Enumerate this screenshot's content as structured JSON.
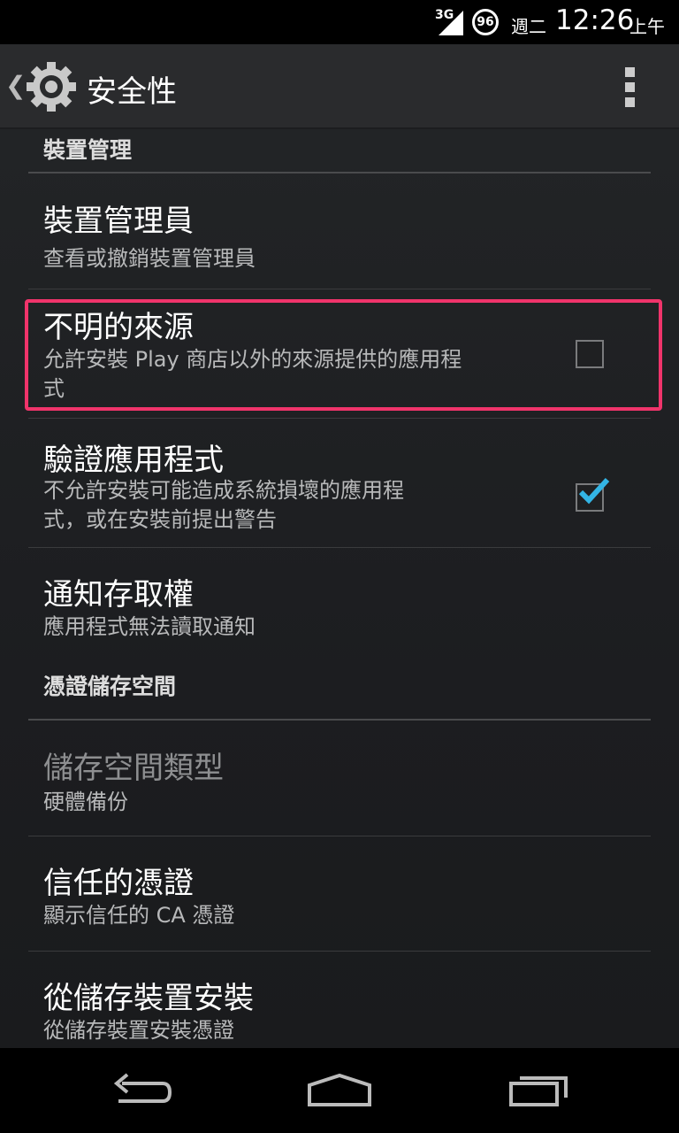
{
  "status_bar": {
    "network": "3G",
    "battery": "96",
    "day": "週二",
    "time": "12:26",
    "ampm": "上午"
  },
  "action_bar": {
    "title": "安全性",
    "icon": "gear-icon",
    "overflow_icon": "overflow-menu-icon"
  },
  "sections": [
    {
      "header": "裝置管理"
    },
    {
      "header": "憑證儲存空間"
    }
  ],
  "items": [
    {
      "title": "裝置管理員",
      "summary": "查看或撤銷裝置管理員"
    },
    {
      "title": "不明的來源",
      "summary_line1": "允許安裝 Play 商店以外的來源提供的應用程",
      "summary_line2": "式",
      "checked": false
    },
    {
      "title": "驗證應用程式",
      "summary_line1": "不允許安裝可能造成系統損壞的應用程",
      "summary_line2": "式，或在安裝前提出警告",
      "checked": true
    },
    {
      "title": "通知存取權",
      "summary": "應用程式無法讀取通知"
    },
    {
      "title": "儲存空間類型",
      "summary": "硬體備份",
      "enabled": false
    },
    {
      "title": "信任的憑證",
      "summary": "顯示信任的 CA 憑證"
    },
    {
      "title": "從儲存裝置安裝",
      "summary": "從儲存裝置安裝憑證"
    }
  ],
  "colors": {
    "highlight": "#f0346b",
    "check": "#33b5e5"
  },
  "nav_bar": [
    "back-icon",
    "home-icon",
    "recent-apps-icon"
  ]
}
